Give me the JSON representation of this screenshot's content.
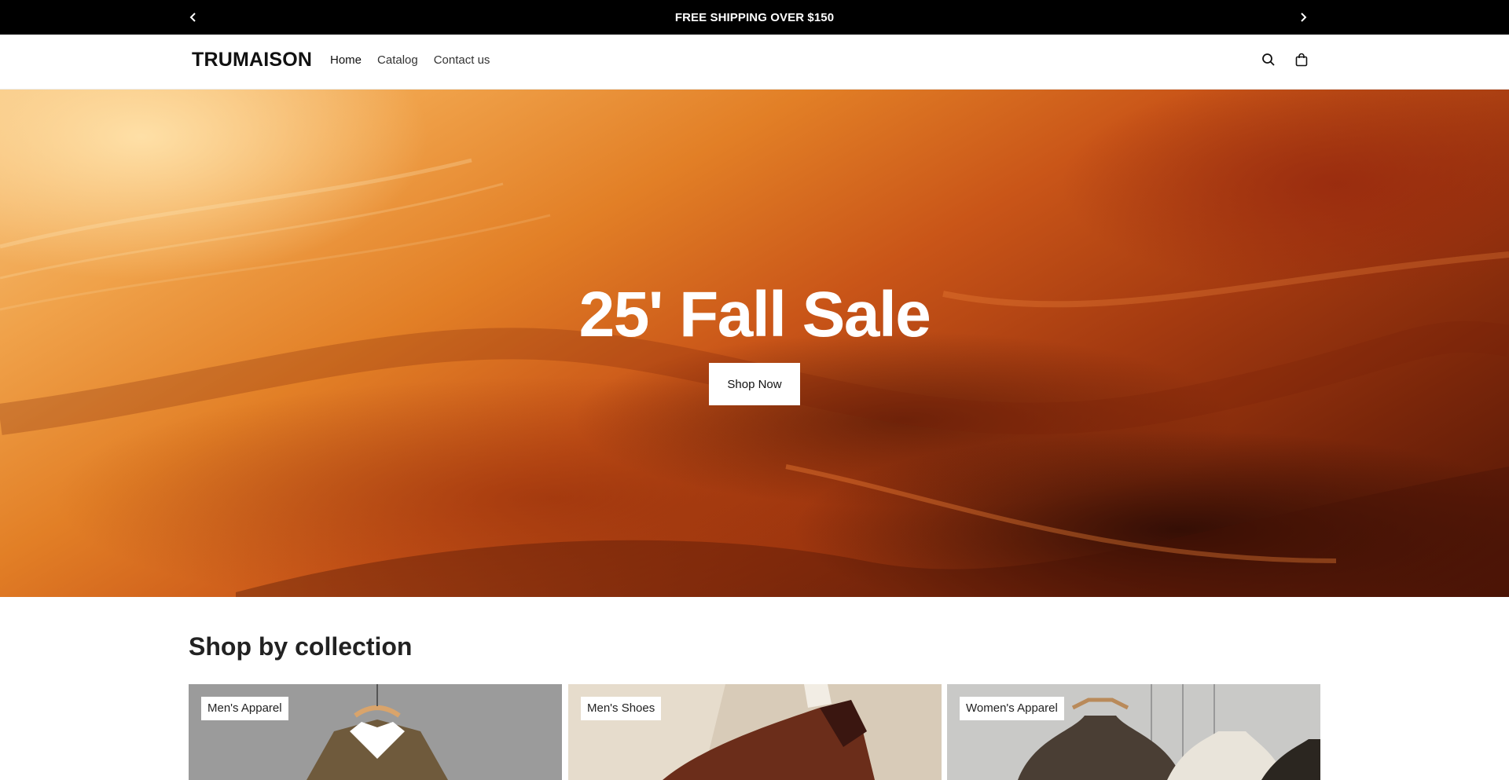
{
  "announcement": {
    "message": "FREE SHIPPING OVER $150",
    "prev_icon": "chevron-left-icon",
    "next_icon": "chevron-right-icon"
  },
  "header": {
    "logo": "TRUMAISON",
    "nav": [
      {
        "label": "Home"
      },
      {
        "label": "Catalog"
      },
      {
        "label": "Contact us"
      }
    ],
    "icons": [
      "search-icon",
      "cart-bag-icon"
    ]
  },
  "hero": {
    "title": "25' Fall Sale",
    "button_label": "Shop Now"
  },
  "collections": {
    "title": "Shop by collection",
    "items": [
      {
        "label": "Men's Apparel"
      },
      {
        "label": "Men's Shoes"
      },
      {
        "label": "Women's Apparel"
      }
    ]
  },
  "colors": {
    "announcement_bg": "#000000",
    "hero_orange": "#e27f26",
    "hero_dark": "#4d1506"
  }
}
